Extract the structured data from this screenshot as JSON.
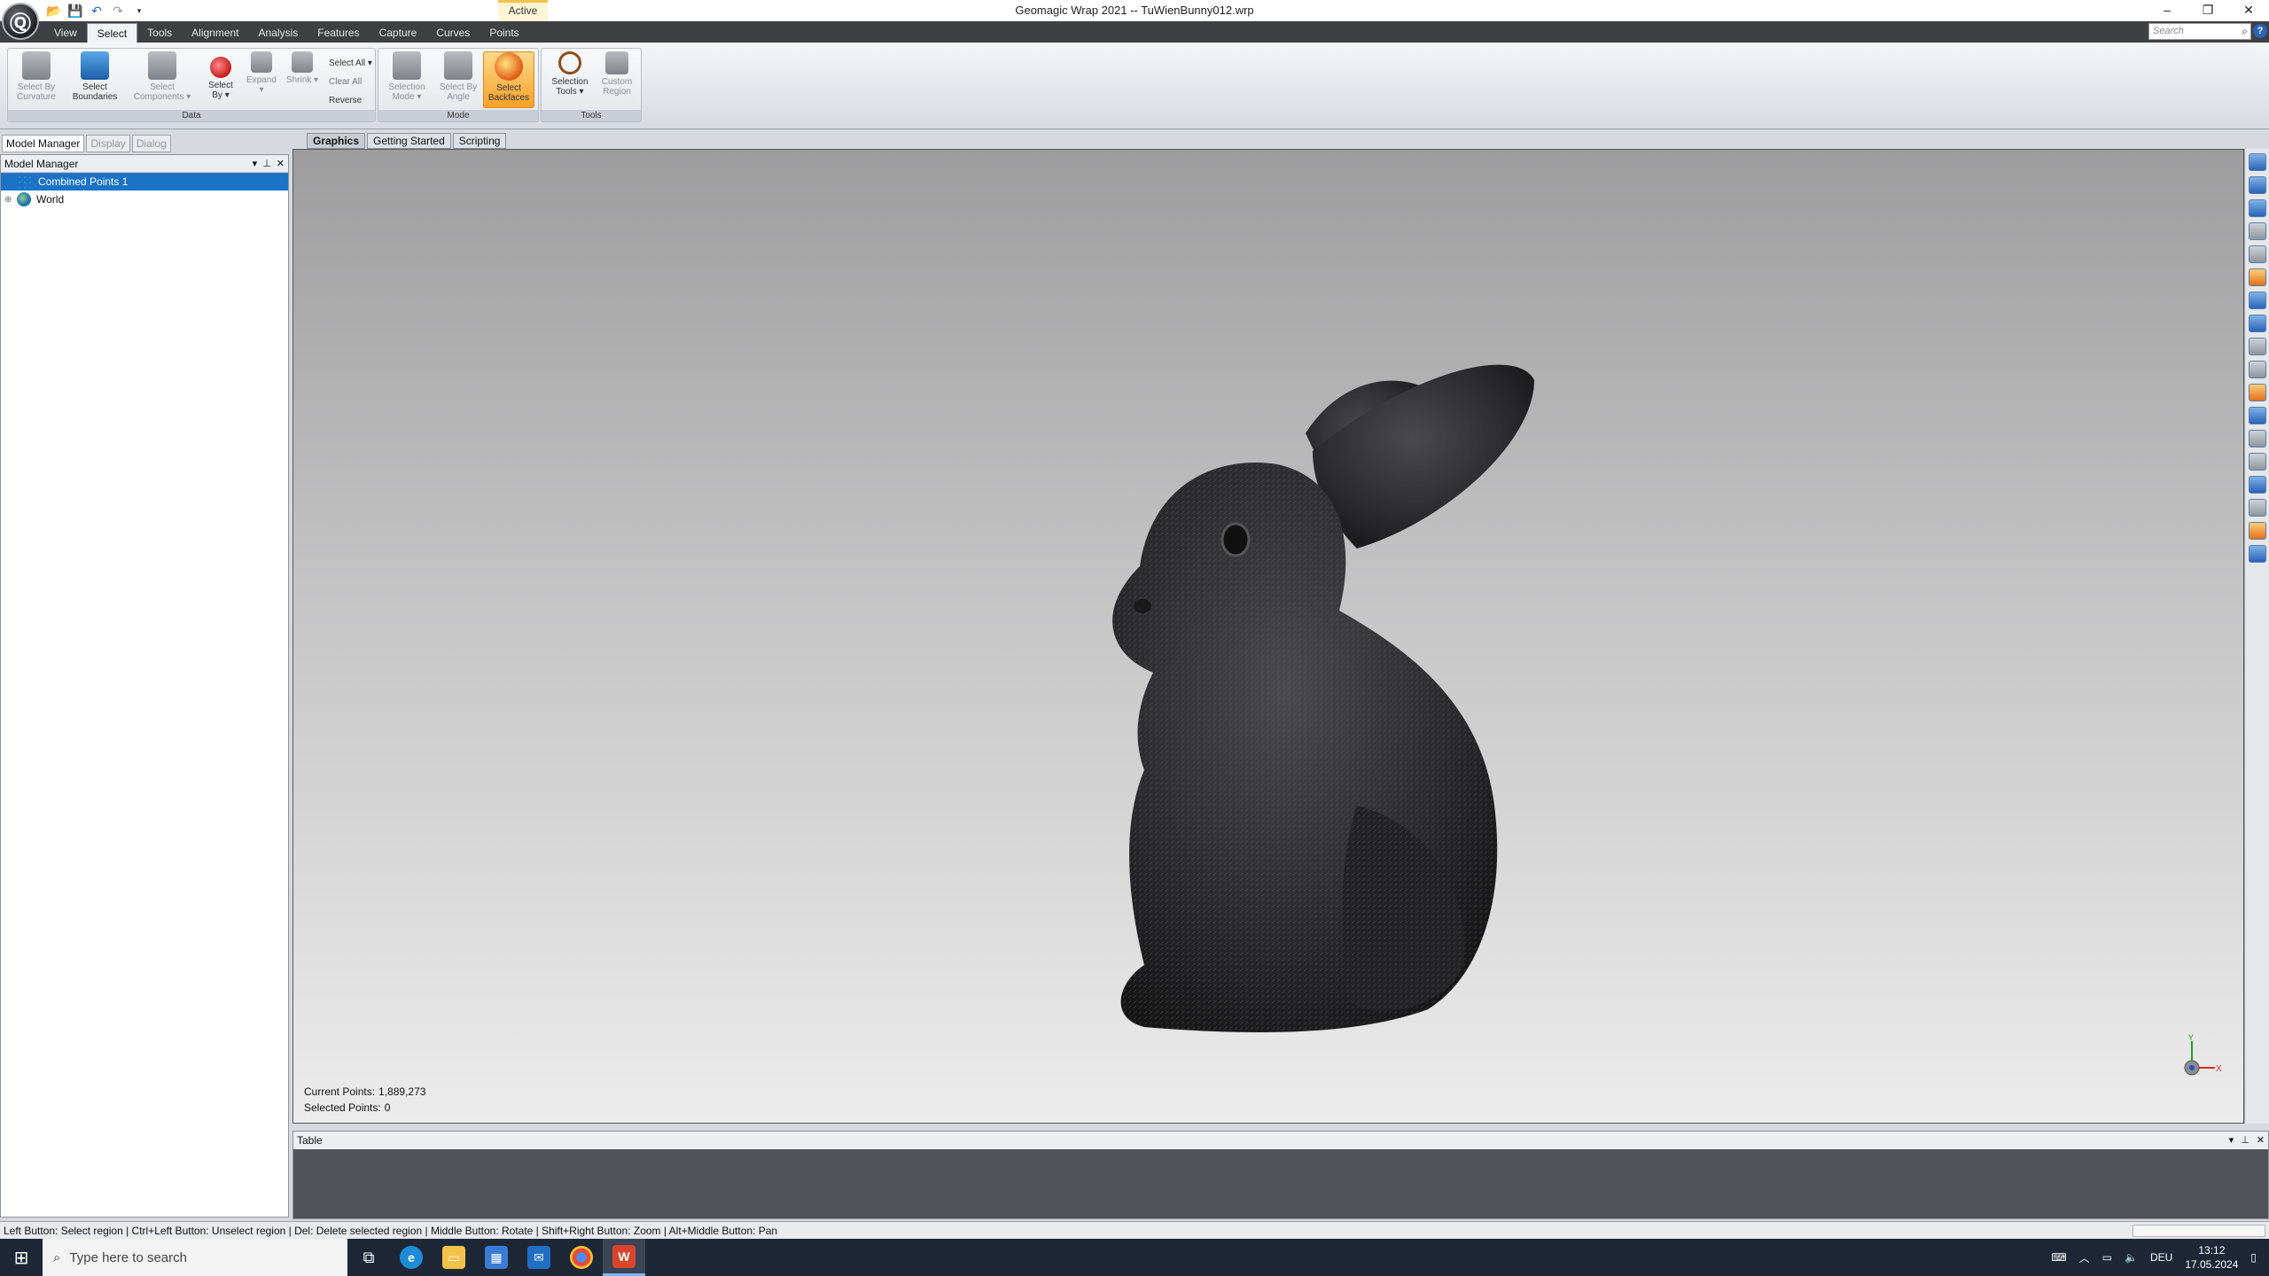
{
  "window": {
    "title": "Geomagic Wrap 2021 -- TuWienBunny012.wrp",
    "context_tab": "Active",
    "controls": [
      "–",
      "❐",
      "✕"
    ]
  },
  "quick_access": [
    "open-icon",
    "save-icon",
    "undo-icon",
    "redo-icon",
    "dropdown-icon"
  ],
  "ribbon": {
    "tabs": [
      "View",
      "Select",
      "Tools",
      "Alignment",
      "Analysis",
      "Features",
      "Capture",
      "Curves",
      "Points"
    ],
    "active_tab": "Select",
    "search_placeholder": "Search",
    "groups": {
      "data": {
        "label": "Data",
        "buttons": [
          {
            "label": "Select By Curvature",
            "enabled": false
          },
          {
            "label": "Select Boundaries",
            "enabled": true
          },
          {
            "label": "Select Components ▾",
            "enabled": false
          },
          {
            "label": "Select By ▾",
            "enabled": true
          },
          {
            "label": "Expand ▾",
            "enabled": false
          },
          {
            "label": "Shrink ▾",
            "enabled": false
          }
        ],
        "small_buttons": [
          "Select All ▾",
          "Clear All",
          "Reverse"
        ]
      },
      "mode": {
        "label": "Mode",
        "buttons": [
          {
            "label": "Selection Mode ▾",
            "enabled": false
          },
          {
            "label": "Select By Angle",
            "enabled": false
          },
          {
            "label": "Select Backfaces",
            "enabled": true,
            "selected": true
          }
        ]
      },
      "tools": {
        "label": "Tools",
        "buttons": [
          {
            "label": "Selection Tools ▾",
            "enabled": true
          },
          {
            "label": "Custom Region",
            "enabled": false
          }
        ]
      }
    }
  },
  "left_panel": {
    "tabs": [
      "Model Manager",
      "Display",
      "Dialog"
    ],
    "header": "Model Manager",
    "tree": [
      {
        "label": "Combined Points 1",
        "selected": true
      },
      {
        "label": "World",
        "selected": false,
        "expander": "⊕"
      }
    ]
  },
  "viewport": {
    "tabs": [
      "Graphics",
      "Getting Started",
      "Scripting"
    ],
    "current_points_label": "Current Points:",
    "current_points_value": "1,889,273",
    "selected_points_label": "Selected Points:",
    "selected_points_value": "0",
    "axis_x": "X",
    "axis_y": "Y"
  },
  "table_panel": {
    "header": "Table"
  },
  "status_bar": {
    "text": "Left Button: Select region | Ctrl+Left Button: Unselect region | Del: Delete selected region | Middle Button: Rotate | Shift+Right Button: Zoom | Alt+Middle Button: Pan"
  },
  "taskbar": {
    "search_placeholder": "Type here to search",
    "apps": [
      "task-view-icon",
      "edge-icon",
      "file-explorer-icon",
      "store-icon",
      "mail-icon",
      "chrome-icon",
      "geomagic-icon"
    ],
    "language": "DEU",
    "time": "13:12",
    "date": "17.05.2024"
  },
  "colors": {
    "selection": "#1a73c6",
    "ribbon_dark": "#3e4044",
    "taskbar": "#1d2736",
    "selected_button": "#f6a12a"
  }
}
